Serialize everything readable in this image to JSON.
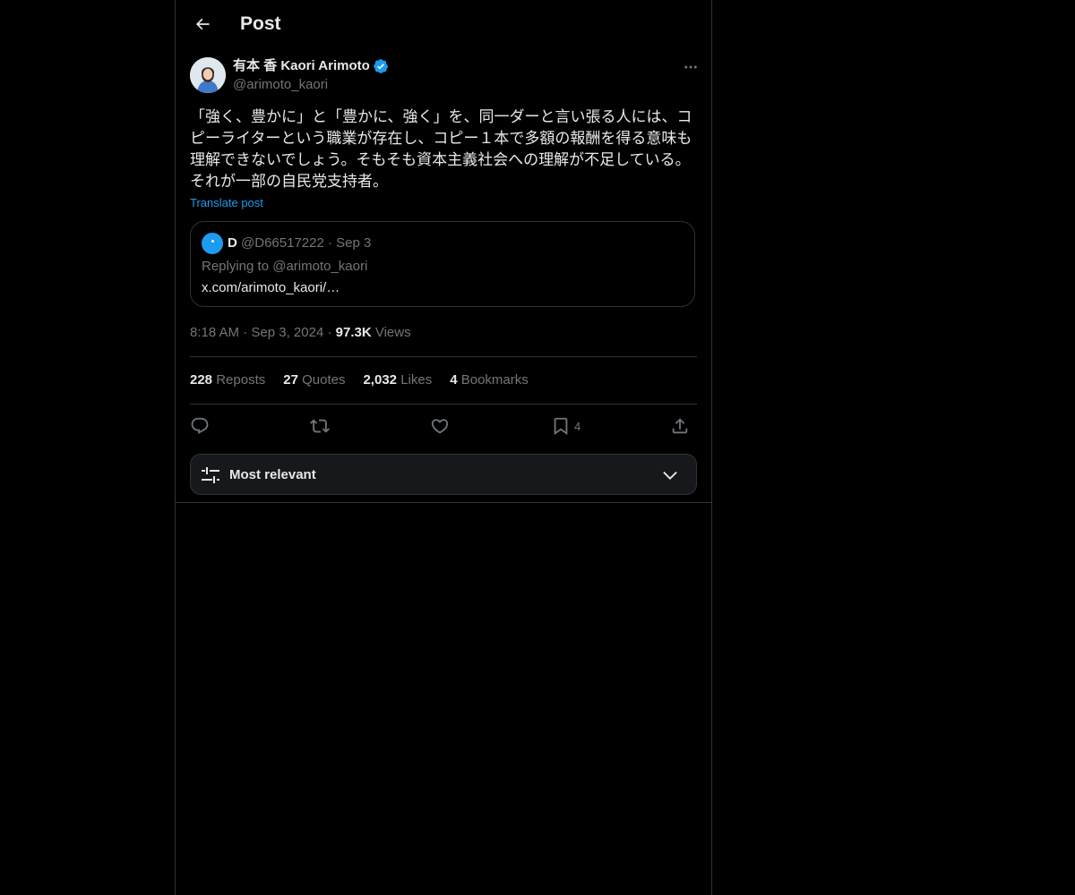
{
  "header": {
    "title": "Post",
    "back_icon": "arrow-left-icon"
  },
  "post": {
    "author": {
      "name": "有本 香 Kaori Arimoto",
      "handle": "@arimoto_kaori",
      "verified": true
    },
    "text": "「強く、豊かに」と「豊かに、強く」を、同一ダーと言い張る人には、コピーライターという職業が存在し、コピー１本で多額の報酬を得る意味も理解できないでしょう。そもそも資本主義社会への理解が不足している。それが一部の自民党支持者。",
    "translate_label": "Translate post",
    "quoted": {
      "name": "D",
      "handle": "@D66517222",
      "separator": "·",
      "date": "Sep 3",
      "replying_to": "Replying to @arimoto_kaori",
      "link": "x.com/arimoto_kaori/…"
    },
    "meta": {
      "time": "8:18 AM",
      "separator": "·",
      "date": "Sep 3, 2024",
      "views_count": "97.3K",
      "views_label": "Views"
    },
    "stats": {
      "reposts_count": "228",
      "reposts_label": "Reposts",
      "quotes_count": "27",
      "quotes_label": "Quotes",
      "likes_count": "2,032",
      "likes_label": "Likes",
      "bookmarks_count": "4",
      "bookmarks_label": "Bookmarks"
    },
    "actions": {
      "reply_icon": "reply-icon",
      "repost_icon": "repost-icon",
      "like_icon": "heart-icon",
      "bookmark_icon": "bookmark-icon",
      "bookmark_count": "4",
      "share_icon": "share-icon"
    }
  },
  "replies_sort": {
    "label": "Most relevant",
    "icon": "sliders-icon",
    "chevron": "chevron-down-icon"
  },
  "colors": {
    "background": "#000000",
    "text_primary": "#e7e9ea",
    "text_secondary": "#71767b",
    "accent": "#1d9bf0",
    "border": "#2f3336"
  }
}
